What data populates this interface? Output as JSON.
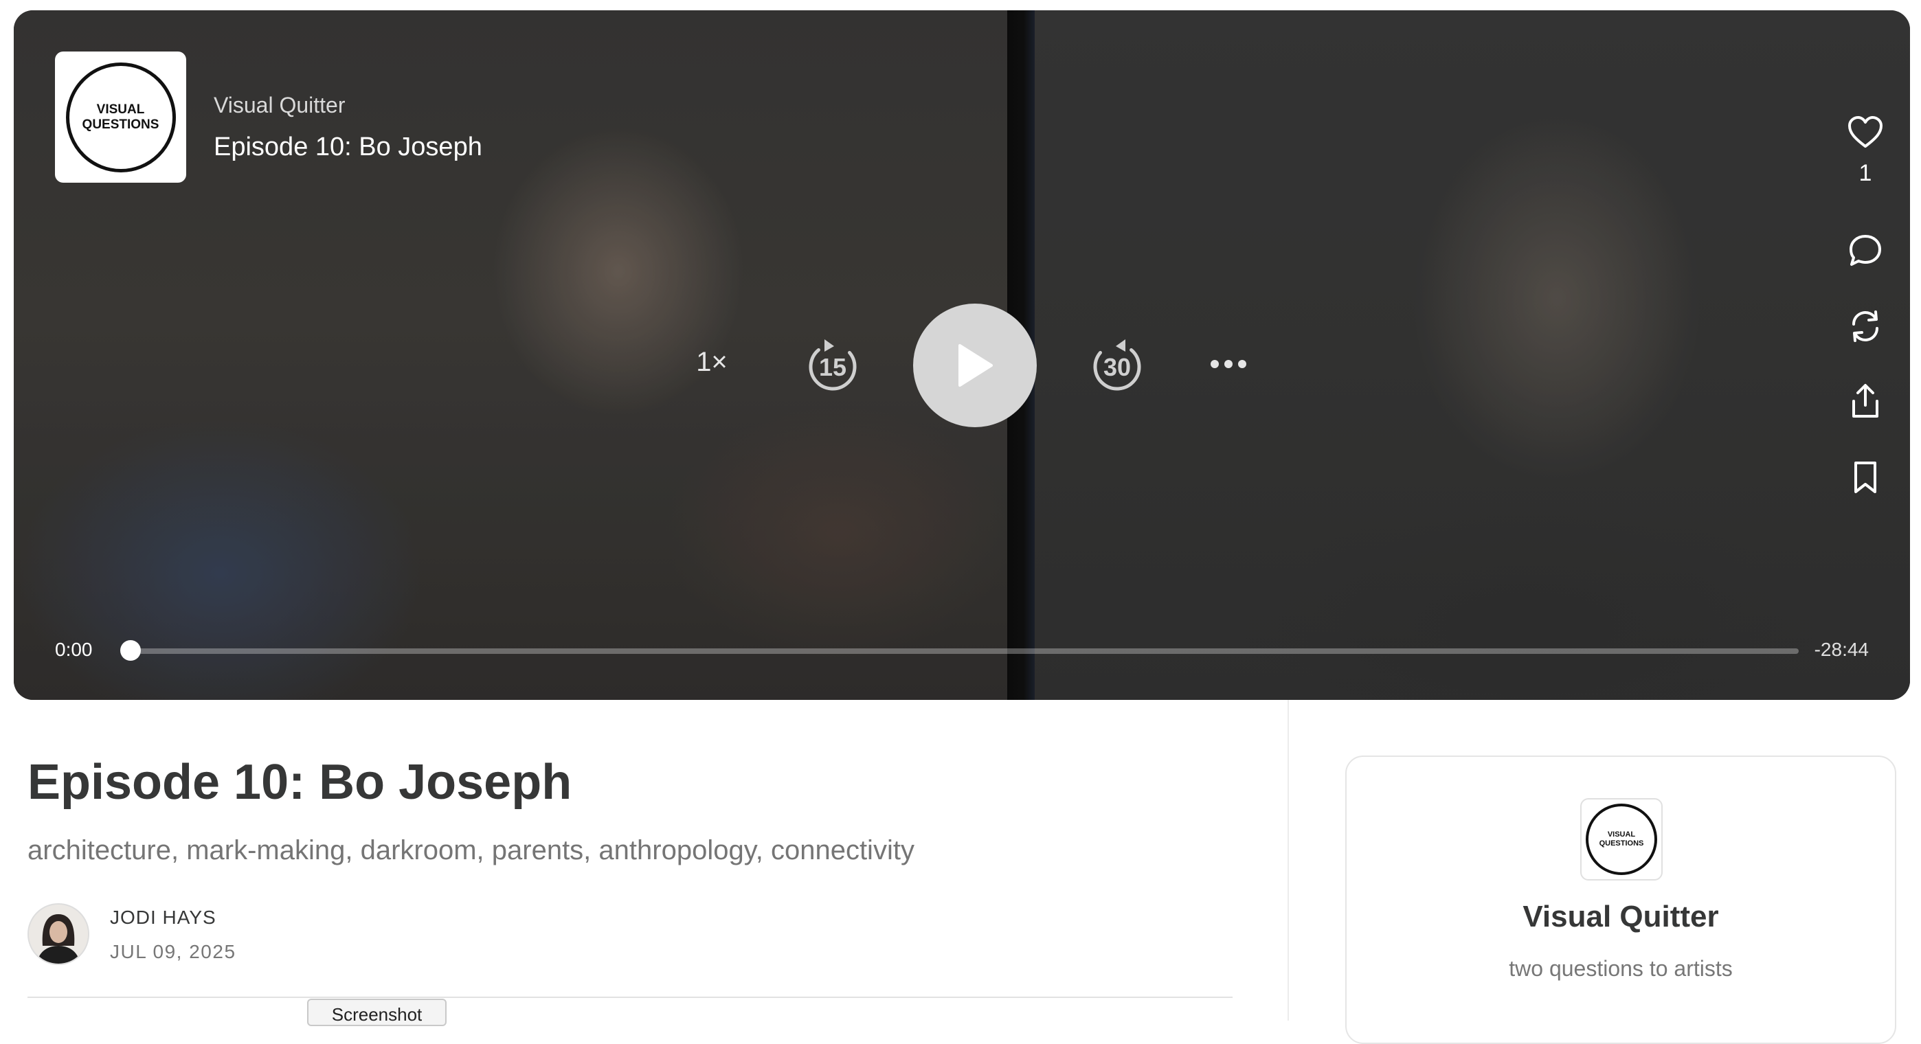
{
  "player": {
    "publication": "Visual Quitter",
    "episode_title": "Episode 10: Bo Joseph",
    "cover_text_line1": "VISUAL",
    "cover_text_line2": "QUESTIONS",
    "speed": "1×",
    "skip_back_seconds": "15",
    "skip_forward_seconds": "30",
    "like_count": "1",
    "time_elapsed": "0:00",
    "time_remaining": "-28:44",
    "progress_fraction": 0.0
  },
  "post": {
    "title": "Episode 10: Bo Joseph",
    "subtitle": "architecture, mark-making, darkroom, parents, anthropology, connectivity",
    "author": "JODI HAYS",
    "date": "JUL 09, 2025"
  },
  "tooltip": {
    "label": "Screenshot"
  },
  "publication_card": {
    "name": "Visual Quitter",
    "tagline": "two questions to artists",
    "logo_line1": "VISUAL",
    "logo_line2": "QUESTIONS"
  },
  "icons": {
    "like": "heart-icon",
    "comment": "comment-icon",
    "restack": "restack-icon",
    "share": "share-icon",
    "save": "bookmark-icon",
    "more": "more-horizontal-icon",
    "play": "play-icon"
  }
}
